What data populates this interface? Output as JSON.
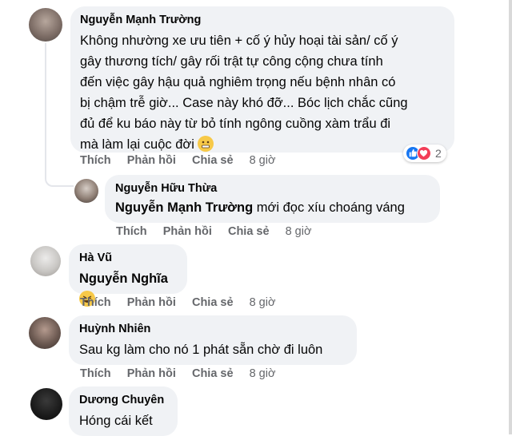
{
  "comments": [
    {
      "author": "Nguyễn Mạnh Trường",
      "lines": [
        "Không nhường xe ưu tiên + cố ý hủy hoại tài sản/ cố ý",
        "gây thương tích/ gây rối trật tự công cộng chưa tính",
        "đến việc gây hậu quả nghiêm trọng nếu bệnh nhân có",
        "bị chậm trễ giờ... Case này khó đỡ... Bóc lịch chắc cũng",
        "đủ để ku báo này từ bỏ tính ngông cuồng xàm trẩu đi",
        "mà làm lại cuộc đời"
      ],
      "like": "Thích",
      "reply": "Phản hồi",
      "share": "Chia sẻ",
      "time": "8 giờ",
      "reaction_count": "2"
    },
    {
      "author": "Nguyễn Hữu Thừa",
      "mention": "Nguyễn Mạnh Trường",
      "text": " mới đọc xíu choáng váng",
      "like": "Thích",
      "reply": "Phản hồi",
      "share": "Chia sẻ",
      "time": "8 giờ"
    },
    {
      "author": "Hà Vũ",
      "mention": "Nguyễn Nghĩa",
      "like": "Thích",
      "reply": "Phản hồi",
      "share": "Chia sẻ",
      "time": "8 giờ"
    },
    {
      "author": "Huỳnh Nhiên",
      "text": "Sau kg làm cho nó 1 phát sẵn chờ đi luôn",
      "like": "Thích",
      "reply": "Phản hồi",
      "share": "Chia sẻ",
      "time": "8 giờ"
    },
    {
      "author": "Dương Chuyên",
      "text": "Hóng cái kết"
    }
  ],
  "colors": {
    "bubble": "#f0f2f5",
    "meta": "#65676b",
    "like_blue": "#1877f2",
    "love_red": "#f33e58",
    "emoji_yellow": "#f7c948"
  },
  "icons": [
    "like-reaction-icon",
    "love-reaction-icon",
    "grimace-emoji-icon",
    "laughing-emoji-icon"
  ]
}
